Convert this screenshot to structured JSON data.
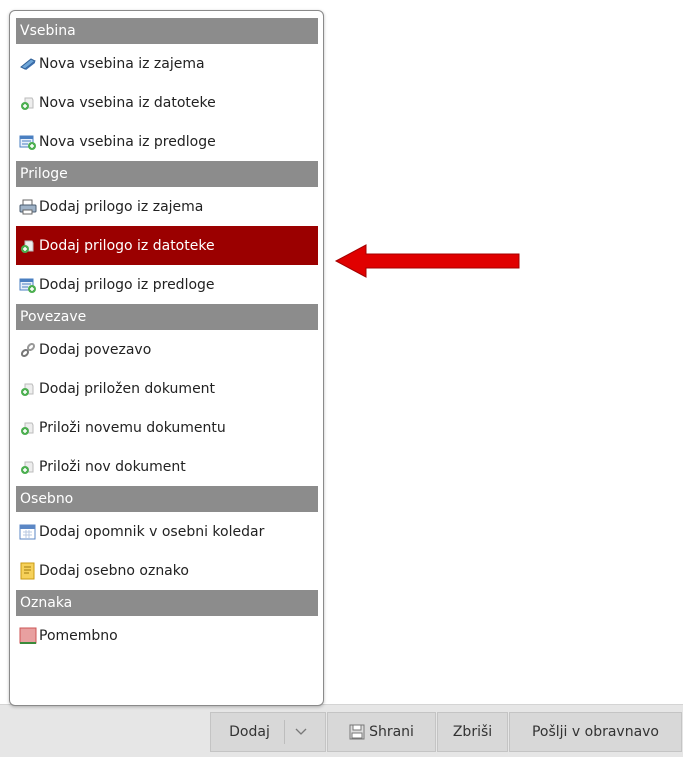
{
  "menu": {
    "sections": [
      {
        "header": "Vsebina",
        "items": [
          {
            "label": "Nova vsebina iz zajema",
            "icon": "scanner-icon"
          },
          {
            "label": "Nova vsebina iz datoteke",
            "icon": "file-add-icon"
          },
          {
            "label": "Nova vsebina iz predloge",
            "icon": "template-icon"
          }
        ]
      },
      {
        "header": "Priloge",
        "items": [
          {
            "label": "Dodaj prilogo iz zajema",
            "icon": "printer-icon"
          },
          {
            "label": "Dodaj prilogo iz datoteke",
            "icon": "file-add-icon",
            "selected": true
          },
          {
            "label": "Dodaj prilogo iz predloge",
            "icon": "template-icon"
          }
        ]
      },
      {
        "header": "Povezave",
        "items": [
          {
            "label": "Dodaj povezavo",
            "icon": "link-icon"
          },
          {
            "label": "Dodaj priložen dokument",
            "icon": "file-add-icon"
          },
          {
            "label": "Priloži novemu dokumentu",
            "icon": "file-add-icon"
          },
          {
            "label": "Priloži nov dokument",
            "icon": "file-add-icon"
          }
        ]
      },
      {
        "header": "Osebno",
        "items": [
          {
            "label": "Dodaj opomnik v osebni koledar",
            "icon": "calendar-icon"
          },
          {
            "label": "Dodaj osebno oznako",
            "icon": "note-icon"
          }
        ]
      },
      {
        "header": "Oznaka",
        "items": [
          {
            "label": "Pomembno",
            "icon": "red-flag-icon"
          }
        ]
      }
    ]
  },
  "toolbar": {
    "dodaj_label": "Dodaj",
    "shrani_label": "Shrani",
    "zbrisi_label": "Zbriši",
    "poslji_label": "Pošlji v obravnavo"
  },
  "colors": {
    "selected_bg": "#9b0000",
    "header_bg": "#8c8c8c",
    "arrow": "#e00000"
  }
}
